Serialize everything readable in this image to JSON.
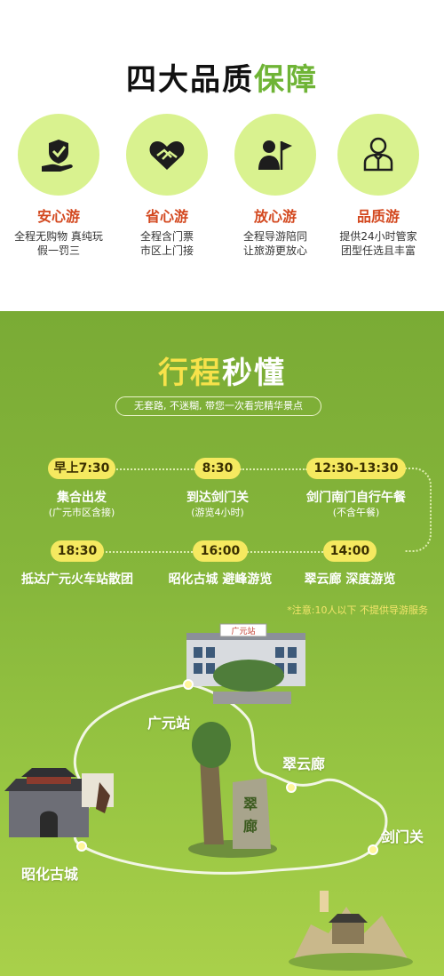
{
  "header": {
    "title_main": "四大品质",
    "title_highlight": "保障"
  },
  "guarantees": [
    {
      "icon": "hand-shield-icon",
      "name": "安心游",
      "desc1": "全程无购物 真纯玩",
      "desc2": "假一罚三"
    },
    {
      "icon": "heart-handshake-icon",
      "name": "省心游",
      "desc1": "全程含门票",
      "desc2": "市区上门接"
    },
    {
      "icon": "guide-flag-icon",
      "name": "放心游",
      "desc1": "全程导游陪同",
      "desc2": "让旅游更放心"
    },
    {
      "icon": "butler-icon",
      "name": "品质游",
      "desc1": "提供24小时管家",
      "desc2": "团型任选且丰富"
    }
  ],
  "itinerary": {
    "title_main": "行程",
    "title_white": "秒懂",
    "subtitle": "无套路, 不迷糊, 带您一次看完精华景点",
    "stops": [
      {
        "time": "早上7:30",
        "name": "集合出发",
        "note": "(广元市区含接)"
      },
      {
        "time": "8:30",
        "name": "到达剑门关",
        "note": "(游览4小时)"
      },
      {
        "time": "12:30-13:30",
        "name": "剑门南门自行午餐",
        "note": "(不含午餐)"
      },
      {
        "time": "14:00",
        "name": "翠云廊 深度游览",
        "note": ""
      },
      {
        "time": "16:00",
        "name": "昭化古城 避峰游览",
        "note": ""
      },
      {
        "time": "18:30",
        "name": "抵达广元火车站散团",
        "note": ""
      }
    ],
    "notice": "*注意:10人以下 不提供导游服务"
  },
  "map": {
    "labels": [
      "广元站",
      "翠云廊",
      "剑门关",
      "昭化古城"
    ],
    "station_sign": "广元站"
  }
}
